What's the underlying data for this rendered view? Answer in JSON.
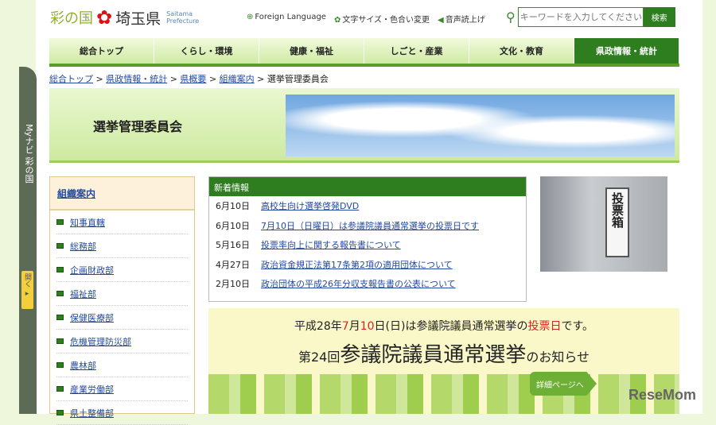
{
  "header": {
    "logo_a": "彩の国",
    "logo_b": "埼玉県",
    "logo_en1": "Saitama",
    "logo_en2": "Prefecture",
    "util": [
      {
        "icon": "globe-icon",
        "glyph": "⊕",
        "label": "Foreign Language"
      },
      {
        "icon": "gear-icon",
        "glyph": "✿",
        "label": "文字サイズ・色合い変更"
      },
      {
        "icon": "speaker-icon",
        "glyph": "◀",
        "label": "音声読上げ"
      }
    ],
    "search_placeholder": "キーワードを入力してください",
    "search_button": "検索"
  },
  "nav": [
    "総合トップ",
    "くらし・環境",
    "健康・福祉",
    "しごと・産業",
    "文化・教育",
    "県政情報・統計"
  ],
  "breadcrumb": {
    "links": [
      "総合トップ",
      "県政情報・統計",
      "県概要",
      "組織案内"
    ],
    "current": "選挙管理委員会",
    "sep": ">"
  },
  "mynavi": {
    "label": "Myナビ 彩の国",
    "open": "開く ▸"
  },
  "hero_title": "選挙管理委員会",
  "side": {
    "title": "組織案内",
    "items": [
      "知事直轄",
      "総務部",
      "企画財政部",
      "福祉部",
      "保健医療部",
      "危機管理防災部",
      "農林部",
      "産業労働部",
      "県土整備部"
    ]
  },
  "news": {
    "title": "新着情報",
    "items": [
      {
        "date": "6月10日",
        "text": "高校生向け選挙啓発DVD"
      },
      {
        "date": "6月10日",
        "text": "7月10日（日曜日）は参議院議員通常選挙の投票日です"
      },
      {
        "date": "5月16日",
        "text": "投票率向上に関する報告書について"
      },
      {
        "date": "4月27日",
        "text": "政治資金規正法第17条第2項の適用団体について"
      },
      {
        "date": "2月10日",
        "text": "政治団体の平成26年分収支報告書の公表について"
      }
    ]
  },
  "photo_text": "投票箱",
  "banner": {
    "l1a": "平成28年",
    "l1b": "7",
    "l1c": "月",
    "l1d": "10",
    "l1e": "日(日)は参議院議員通常選挙の",
    "l1f": "投票日",
    "l1g": "です。",
    "l2a": "第24回",
    "l2b": "参議院議員通常選挙",
    "l2c": "のお知らせ",
    "button": "詳細ページへ"
  },
  "watermark": "ReseMom"
}
